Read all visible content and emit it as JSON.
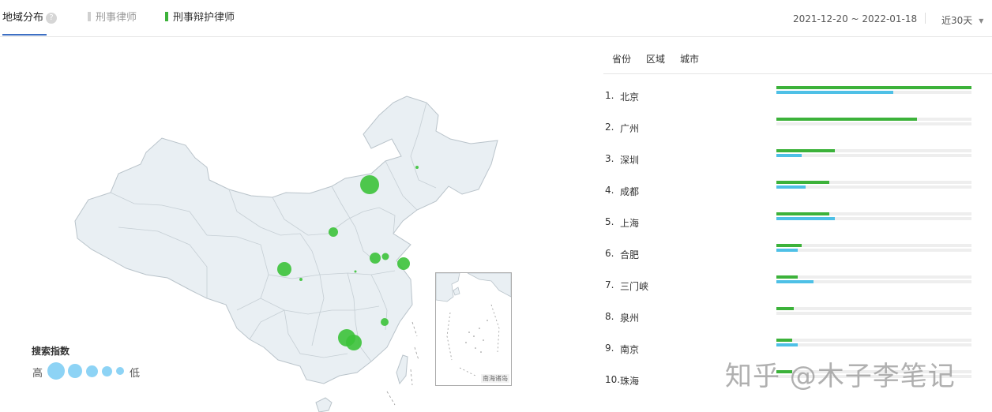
{
  "header": {
    "tabs": {
      "region": "地域分布",
      "legend1": "刑事律师",
      "legend2": "刑事辩护律师"
    },
    "help_symbol": "?",
    "date_range": "2021-12-20 ~ 2022-01-18",
    "range_select": "近30天"
  },
  "colors": {
    "series1": "#d0d0d0",
    "series2": "#3cb23a",
    "series2_alt": "#4ec0e6",
    "accent": "#3d6fc3",
    "bubble": "#3cc23a",
    "map_fill": "#e9eff3",
    "map_stroke": "#b9c3ca"
  },
  "map": {
    "inset_label": "南海诸岛",
    "legend": {
      "title": "搜索指数",
      "high": "高",
      "low": "低"
    }
  },
  "ranking": {
    "subtabs": [
      "省份",
      "区域",
      "城市"
    ],
    "rows": [
      {
        "rank": "1.",
        "name": "北京",
        "green": 1.0,
        "blue": 0.6
      },
      {
        "rank": "2.",
        "name": "广州",
        "green": 0.72,
        "blue": 0.0
      },
      {
        "rank": "3.",
        "name": "深圳",
        "green": 0.3,
        "blue": 0.13
      },
      {
        "rank": "4.",
        "name": "成都",
        "green": 0.27,
        "blue": 0.15
      },
      {
        "rank": "5.",
        "name": "上海",
        "green": 0.27,
        "blue": 0.3
      },
      {
        "rank": "6.",
        "name": "合肥",
        "green": 0.13,
        "blue": 0.11
      },
      {
        "rank": "7.",
        "name": "三门峡",
        "green": 0.11,
        "blue": 0.19
      },
      {
        "rank": "8.",
        "name": "泉州",
        "green": 0.09,
        "blue": 0.0
      },
      {
        "rank": "9.",
        "name": "南京",
        "green": 0.08,
        "blue": 0.11
      },
      {
        "rank": "10.",
        "name": "珠海",
        "green": 0.08,
        "blue": 0.0
      }
    ]
  },
  "watermark": "知乎 @木子李笔记"
}
